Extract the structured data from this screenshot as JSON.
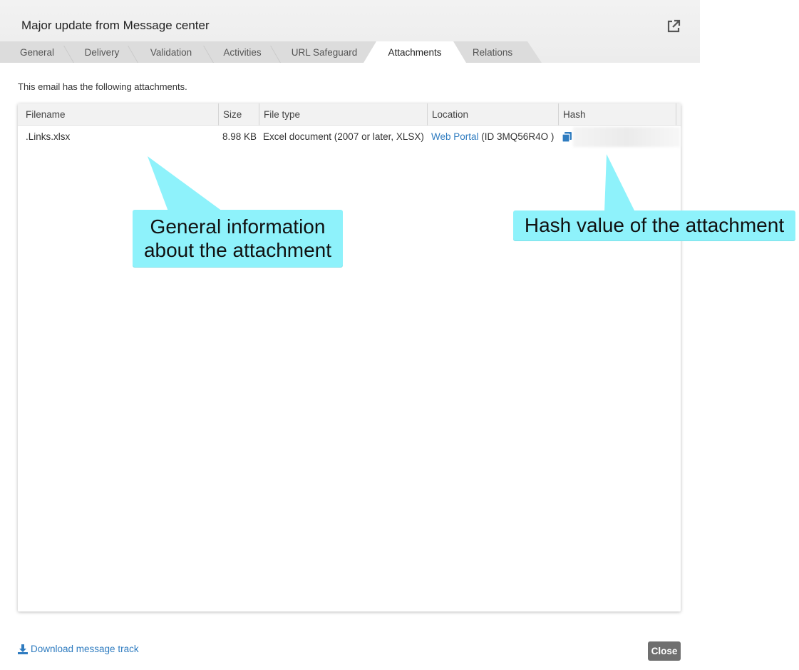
{
  "dialog": {
    "title": "Major update from Message center",
    "intro_text": "This email has the following attachments."
  },
  "tabs": [
    {
      "label": "General"
    },
    {
      "label": "Delivery"
    },
    {
      "label": "Validation"
    },
    {
      "label": "Activities"
    },
    {
      "label": "URL Safeguard"
    },
    {
      "label": "Attachments",
      "active": true
    },
    {
      "label": "Relations"
    }
  ],
  "table": {
    "columns": [
      "Filename",
      "Size",
      "File type",
      "Location",
      "Hash"
    ],
    "rows": [
      {
        "filename": ".Links.xlsx",
        "size": "8.98 KB",
        "file_type": "Excel document (2007 or later, XLSX)",
        "location_link": "Web Portal",
        "location_id": "(ID 3MQ56R4O )"
      }
    ]
  },
  "callouts": {
    "general_info": "General information about the attachment",
    "hash_value": "Hash value of the attachment"
  },
  "footer": {
    "download_link": "Download message track",
    "close_label": "Close"
  },
  "colors": {
    "link": "#2f7cc0",
    "callout": "#8ef2fb",
    "close_button": "#6f6f6f"
  }
}
